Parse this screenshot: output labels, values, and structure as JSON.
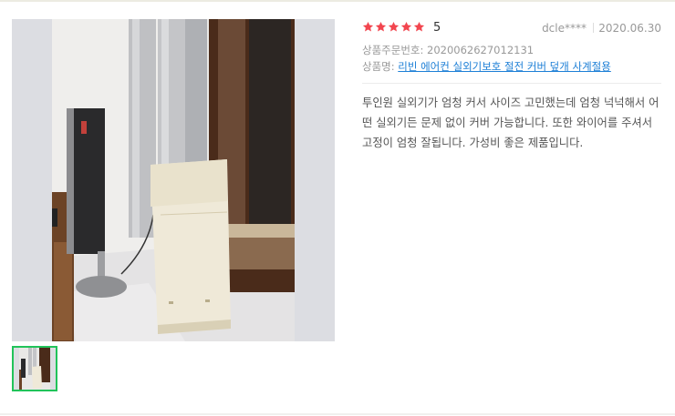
{
  "review": {
    "rating": 5,
    "rating_label": "5",
    "author": "dcle****",
    "date": "2020.06.30",
    "order_label": "상품주문번호:",
    "order_number": "2020062627012131",
    "product_label": "상품명:",
    "product_name": "리빈 에어컨 실외기보호 절전 커버 덮개 사계절용",
    "text": "투인원 실외기가 엄청 커서 사이즈 고민했는데 엄청 넉넉해서 어떤 실외기든 문제 없이 커버 가능합니다. 또한 와이어를 주셔서 고정이 엄청 잘됩니다. 가성비 좋은 제품입니다."
  },
  "colors": {
    "star": "#f2464f",
    "link": "#1d7fd6",
    "thumb_border": "#21c35a"
  },
  "icons": [
    "star-icon"
  ]
}
